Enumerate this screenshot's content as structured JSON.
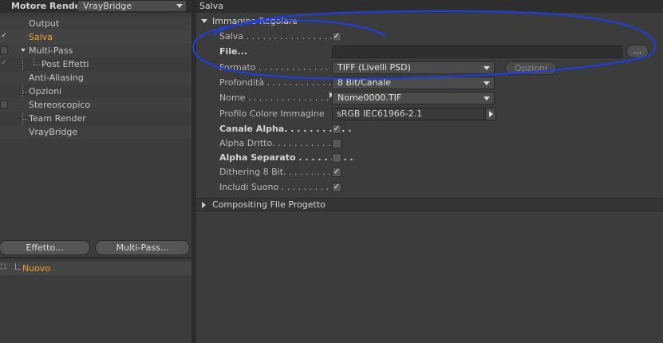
{
  "left": {
    "renderer_label": "Motore Render",
    "renderer_value": "VrayBridge",
    "tree": [
      {
        "label": "Output",
        "checkbox": "none",
        "selected": false
      },
      {
        "label": "Salva",
        "checkbox": "checked",
        "selected": true
      },
      {
        "label": "Multi-Pass",
        "checkbox": "empty",
        "selected": false
      },
      {
        "label": "Post Effetti",
        "checkbox": "checked-flat",
        "selected": false
      },
      {
        "label": "Anti-Aliasing",
        "checkbox": "none",
        "selected": false
      },
      {
        "label": "Opzioni",
        "checkbox": "none",
        "selected": false
      },
      {
        "label": "Stereoscopico",
        "checkbox": "empty",
        "selected": false
      },
      {
        "label": "Team Render",
        "checkbox": "none",
        "selected": false
      },
      {
        "label": "VrayBridge",
        "checkbox": "none",
        "selected": false
      }
    ],
    "effetto_button": "Effetto...",
    "multipass_button": "Multi-Pass...",
    "preset_label": "Nuovo"
  },
  "right": {
    "title": "Salva",
    "section1": "Immagine Regolare",
    "salva_label": "Salva . . . . . . . . . . . . . . . . .",
    "file_label": "File...",
    "file_value": "",
    "file_button": "...",
    "formato_label": "Formato . . . . . . . . . . . . . . .",
    "formato_value": "TIFF (Livelli PSD)",
    "opzioni_button": "Opzioni",
    "profondita_label": "Profondità . . . . . . . . . . . . .",
    "profondita_value": "8 Bit/Canale",
    "nome_label": "Nome . . . . . . . . . . . . . . . . .",
    "nome_value": "Nome0000.TIF",
    "profilo_label": "Profilo Colore Immagine",
    "profilo_value": "sRGB IEC61966-2.1",
    "canale_alpha_label": "Canale Alpha. . . . . . . . . . .",
    "alpha_dritto_label": "Alpha Dritto. . . . . . . . . . . . .",
    "alpha_separato_label": "Alpha Separato . . . . . . . . .",
    "dithering_label": "Dithering 8 Bit. . . . . . . . . . .",
    "includi_suono_label": "Includi Suono . . . . . . . . . . .",
    "section2": "Compositing FIle Progetto",
    "checks": {
      "salva": true,
      "canale_alpha": true,
      "alpha_dritto": false,
      "alpha_separato": false,
      "dithering": true,
      "includi_suono": true
    }
  },
  "colors": {
    "selected_text": "#f0a030",
    "annotation_ink": "#1f3fd8"
  }
}
